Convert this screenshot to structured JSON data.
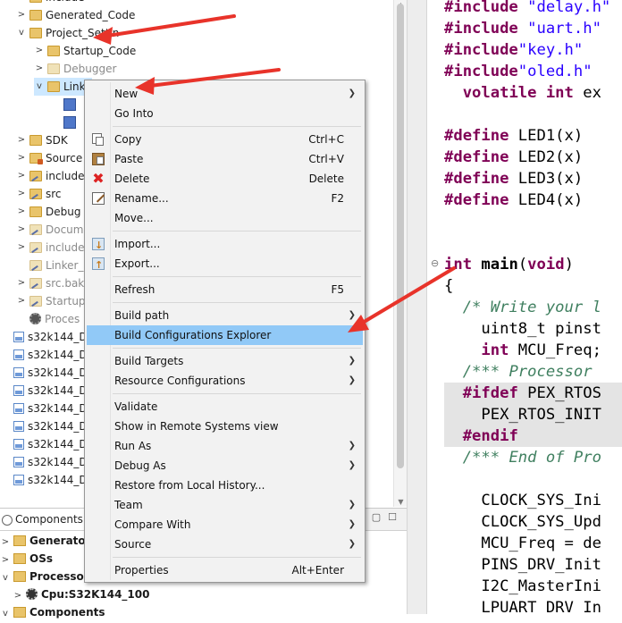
{
  "tree": {
    "rows": [
      {
        "label": "include",
        "twisty": ">",
        "icon": "folder-icon",
        "grey": false
      },
      {
        "label": "Generated_Code",
        "twisty": ">",
        "icon": "folder-icon",
        "grey": false
      },
      {
        "label": "Project_Settin",
        "twisty": "v",
        "icon": "folder-open-icon",
        "grey": false
      },
      {
        "label": "Startup_Code",
        "twisty": ">",
        "icon": "folder-icon",
        "grey": false
      },
      {
        "label": "Debugger",
        "twisty": ">",
        "icon": "folder-icon",
        "grey": true
      },
      {
        "label": "Linke",
        "twisty": "v",
        "icon": "folder-open-icon",
        "grey": false
      },
      {
        "label": "",
        "twisty": "",
        "icon": "linker-file-icon",
        "grey": false
      },
      {
        "label": "",
        "twisty": "",
        "icon": "linker-file-icon",
        "grey": false
      },
      {
        "label": "SDK",
        "twisty": ">",
        "icon": "folder-icon",
        "grey": false
      },
      {
        "label": "Source",
        "twisty": ">",
        "icon": "source-folder-icon",
        "grey": false
      },
      {
        "label": "include",
        "twisty": ">",
        "icon": "folder-link-icon",
        "grey": false
      },
      {
        "label": "src",
        "twisty": ">",
        "icon": "folder-link-icon",
        "grey": false
      },
      {
        "label": "Debug",
        "twisty": ">",
        "icon": "folder-icon",
        "grey": false
      },
      {
        "label": "Docum",
        "twisty": ">",
        "icon": "folder-link-icon",
        "grey": true
      },
      {
        "label": "include",
        "twisty": ">",
        "icon": "folder-link-icon",
        "grey": true
      },
      {
        "label": "Linker_",
        "twisty": "",
        "icon": "folder-link-icon",
        "grey": true
      },
      {
        "label": "src.bak",
        "twisty": ">",
        "icon": "folder-link-icon",
        "grey": true
      },
      {
        "label": "Startup",
        "twisty": ">",
        "icon": "folder-link-icon",
        "grey": true
      },
      {
        "label": "Proces",
        "twisty": "",
        "icon": "processor-icon",
        "grey": true
      },
      {
        "label": "s32k144_D",
        "twisty": "",
        "icon": "project-icon",
        "grey": false
      },
      {
        "label": "s32k144_D",
        "twisty": "",
        "icon": "project-icon",
        "grey": false
      },
      {
        "label": "s32k144_D",
        "twisty": "",
        "icon": "project-icon",
        "grey": false
      },
      {
        "label": "s32k144_D",
        "twisty": "",
        "icon": "project-icon",
        "grey": false
      },
      {
        "label": "s32k144_D",
        "twisty": "",
        "icon": "project-icon",
        "grey": false
      },
      {
        "label": "s32k144_D",
        "twisty": "",
        "icon": "project-icon",
        "grey": false
      },
      {
        "label": "s32k144_D",
        "twisty": "",
        "icon": "project-icon",
        "grey": false
      },
      {
        "label": "s32k144_D",
        "twisty": "",
        "icon": "project-icon",
        "grey": false
      },
      {
        "label": "s32k144_D",
        "twisty": "",
        "icon": "project-icon",
        "grey": false
      }
    ]
  },
  "components": {
    "tab_label": "Components",
    "rows": [
      {
        "label": "Generator",
        "twisty": ">",
        "icon": "folder-icon"
      },
      {
        "label": "OSs",
        "twisty": ">",
        "icon": "folder-icon"
      },
      {
        "label": "Processor",
        "twisty": "v",
        "icon": "folder-icon"
      },
      {
        "label": "Cpu:S32K144_100",
        "twisty": ">",
        "icon": "cpu-icon"
      },
      {
        "label": "Components",
        "twisty": "v",
        "icon": "folder-icon"
      }
    ],
    "window_buttons": [
      "▢",
      "☐"
    ]
  },
  "context_menu": {
    "items": [
      {
        "label": "New",
        "shortcut": "",
        "submenu": true,
        "icon": ""
      },
      {
        "label": "Go Into",
        "shortcut": "",
        "submenu": false,
        "icon": ""
      },
      {
        "sep": true
      },
      {
        "label": "Copy",
        "shortcut": "Ctrl+C",
        "submenu": false,
        "icon": "copy-icon"
      },
      {
        "label": "Paste",
        "shortcut": "Ctrl+V",
        "submenu": false,
        "icon": "paste-icon"
      },
      {
        "label": "Delete",
        "shortcut": "Delete",
        "submenu": false,
        "icon": "delete-icon"
      },
      {
        "label": "Rename...",
        "shortcut": "F2",
        "submenu": false,
        "icon": "rename-icon"
      },
      {
        "label": "Move...",
        "shortcut": "",
        "submenu": false,
        "icon": ""
      },
      {
        "sep": true
      },
      {
        "label": "Import...",
        "shortcut": "",
        "submenu": false,
        "icon": "import-icon"
      },
      {
        "label": "Export...",
        "shortcut": "",
        "submenu": false,
        "icon": "export-icon"
      },
      {
        "sep": true
      },
      {
        "label": "Refresh",
        "shortcut": "F5",
        "submenu": false,
        "icon": ""
      },
      {
        "sep": true
      },
      {
        "label": "Build path",
        "shortcut": "",
        "submenu": true,
        "icon": ""
      },
      {
        "label": "Build Configurations Explorer",
        "shortcut": "",
        "submenu": false,
        "icon": "",
        "selected": true
      },
      {
        "sep": true
      },
      {
        "label": "Build Targets",
        "shortcut": "",
        "submenu": true,
        "icon": ""
      },
      {
        "label": "Resource Configurations",
        "shortcut": "",
        "submenu": true,
        "icon": ""
      },
      {
        "sep": true
      },
      {
        "label": "Validate",
        "shortcut": "",
        "submenu": false,
        "icon": ""
      },
      {
        "label": "Show in Remote Systems view",
        "shortcut": "",
        "submenu": false,
        "icon": ""
      },
      {
        "label": "Run As",
        "shortcut": "",
        "submenu": true,
        "icon": ""
      },
      {
        "label": "Debug As",
        "shortcut": "",
        "submenu": true,
        "icon": ""
      },
      {
        "label": "Restore from Local History...",
        "shortcut": "",
        "submenu": false,
        "icon": ""
      },
      {
        "label": "Team",
        "shortcut": "",
        "submenu": true,
        "icon": ""
      },
      {
        "label": "Compare With",
        "shortcut": "",
        "submenu": true,
        "icon": ""
      },
      {
        "label": "Source",
        "shortcut": "",
        "submenu": true,
        "icon": ""
      },
      {
        "sep": true
      },
      {
        "label": "Properties",
        "shortcut": "Alt+Enter",
        "submenu": false,
        "icon": ""
      }
    ]
  },
  "editor": {
    "lines": [
      {
        "tokens": [
          [
            "kw",
            "#include "
          ],
          [
            "str",
            "\"delay.h\""
          ]
        ]
      },
      {
        "tokens": [
          [
            "kw",
            "#include "
          ],
          [
            "str",
            "\"uart.h\""
          ]
        ]
      },
      {
        "tokens": [
          [
            "kw",
            "#include"
          ],
          [
            "str",
            "\"key.h\""
          ]
        ]
      },
      {
        "tokens": [
          [
            "kw",
            "#include"
          ],
          [
            "str",
            "\"oled.h\""
          ]
        ]
      },
      {
        "tokens": [
          [
            "",
            "  "
          ],
          [
            "kw",
            "volatile int"
          ],
          [
            "",
            " ex"
          ]
        ]
      },
      {
        "tokens": []
      },
      {
        "tokens": [
          [
            "kw",
            "#define"
          ],
          [
            "",
            " LED1(x)"
          ]
        ]
      },
      {
        "tokens": [
          [
            "kw",
            "#define"
          ],
          [
            "",
            " LED2(x)"
          ]
        ]
      },
      {
        "tokens": [
          [
            "kw",
            "#define"
          ],
          [
            "",
            " LED3(x)"
          ]
        ]
      },
      {
        "tokens": [
          [
            "kw",
            "#define"
          ],
          [
            "",
            " LED4(x)"
          ]
        ]
      },
      {
        "tokens": []
      },
      {
        "tokens": []
      },
      {
        "tokens": [
          [
            "kw",
            "int"
          ],
          [
            "",
            " "
          ],
          [
            "b",
            "main"
          ],
          [
            "",
            "("
          ],
          [
            "kw",
            "void"
          ],
          [
            "",
            ")"
          ]
        ],
        "fold": "⊖"
      },
      {
        "tokens": [
          [
            "",
            "{"
          ]
        ]
      },
      {
        "tokens": [
          [
            "",
            "  "
          ],
          [
            "cm",
            "/* Write your l"
          ]
        ]
      },
      {
        "tokens": [
          [
            "",
            "    uint8_t pinst"
          ]
        ]
      },
      {
        "tokens": [
          [
            "",
            "    "
          ],
          [
            "kw",
            "int"
          ],
          [
            "",
            " MCU_Freq;"
          ]
        ]
      },
      {
        "tokens": [
          [
            "",
            "  "
          ],
          [
            "cm",
            "/*** Processor"
          ]
        ]
      },
      {
        "tokens": [
          [
            "",
            "  "
          ],
          [
            "kw",
            "#ifdef"
          ],
          [
            "",
            " PEX_RTOS"
          ]
        ],
        "hl": true
      },
      {
        "tokens": [
          [
            "",
            "    PEX_RTOS_INIT"
          ]
        ],
        "hl": true
      },
      {
        "tokens": [
          [
            "",
            "  "
          ],
          [
            "kw",
            "#endif"
          ]
        ],
        "hl": true
      },
      {
        "tokens": [
          [
            "",
            "  "
          ],
          [
            "cm",
            "/*** End of Pro"
          ]
        ]
      },
      {
        "tokens": []
      },
      {
        "tokens": [
          [
            "",
            "    CLOCK_SYS_Ini"
          ]
        ]
      },
      {
        "tokens": [
          [
            "",
            "    CLOCK_SYS_Upd"
          ]
        ]
      },
      {
        "tokens": [
          [
            "",
            "    MCU_Freq = de"
          ]
        ]
      },
      {
        "tokens": [
          [
            "",
            "    PINS_DRV_Init"
          ]
        ]
      },
      {
        "tokens": [
          [
            "",
            "    I2C_MasterIni"
          ]
        ]
      },
      {
        "tokens": [
          [
            "",
            "    LPUART_DRV_In"
          ]
        ]
      }
    ]
  },
  "colors": {
    "menu_selection": "#91c9f7",
    "annotation_arrow": "#e8332a",
    "keyword": "#7f0055",
    "string": "#2a00ff",
    "comment": "#3f7f5f"
  }
}
